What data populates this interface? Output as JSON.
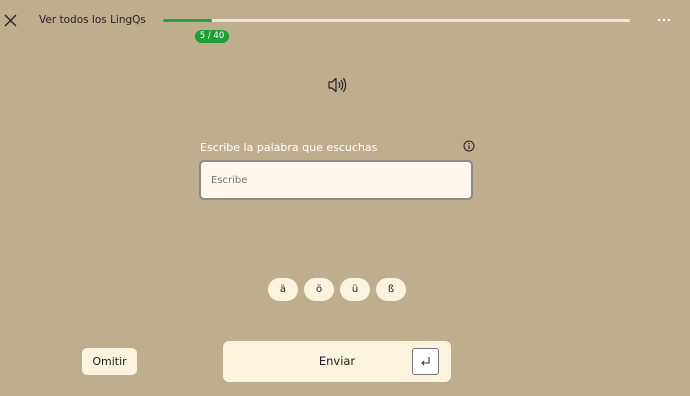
{
  "header": {
    "back_link_label": "Ver todos los LingQs",
    "progress_fraction": 0.105,
    "progress_badge": "5 / 40"
  },
  "exercise": {
    "prompt": "Escribe la palabra que escuchas",
    "input_placeholder": "Escribe"
  },
  "special_characters": [
    "ä",
    "ö",
    "ü",
    "ß"
  ],
  "footer": {
    "skip_label": "Omitir",
    "submit_label": "Enviar"
  },
  "colors": {
    "background": "#bfae8d",
    "progress_fill": "#1ea33a",
    "badge": "#1e9e34",
    "card": "#fcf3de"
  },
  "icons": [
    "close-icon",
    "more-icon",
    "speaker-icon",
    "info-icon",
    "enter-icon"
  ]
}
